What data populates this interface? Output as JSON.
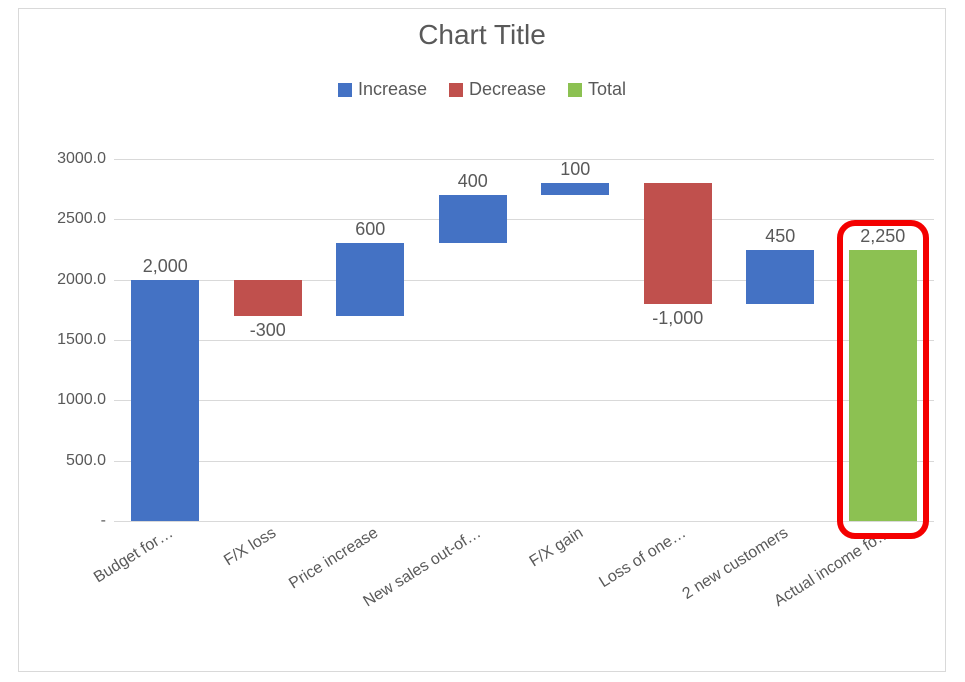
{
  "chart_data": {
    "type": "waterfall",
    "title": "Chart Title",
    "ylabel": "",
    "xlabel": "",
    "ylim": [
      0,
      3000
    ],
    "y_ticks": [
      0,
      500,
      1000,
      1500,
      2000,
      2500,
      3000
    ],
    "y_tick_labels": [
      "-",
      "500.0",
      "1000.0",
      "1500.0",
      "2000.0",
      "2500.0",
      "3000.0"
    ],
    "legend": [
      {
        "name": "Increase",
        "color": "#4472c4"
      },
      {
        "name": "Decrease",
        "color": "#c0504d"
      },
      {
        "name": "Total",
        "color": "#8cc152"
      }
    ],
    "categories_full": [
      "Budget for…",
      "F/X loss",
      "Price increase",
      "New sales out-of…",
      "F/X gain",
      "Loss of one…",
      "2 new customers",
      "Actual income fo…"
    ],
    "series": [
      {
        "category": "Budget for…",
        "value": 2000,
        "label": "2,000",
        "kind": "increase",
        "base": 0,
        "top": 2000
      },
      {
        "category": "F/X loss",
        "value": -300,
        "label": "-300",
        "kind": "decrease",
        "base": 1700,
        "top": 2000
      },
      {
        "category": "Price increase",
        "value": 600,
        "label": "600",
        "kind": "increase",
        "base": 1700,
        "top": 2300
      },
      {
        "category": "New sales out-of…",
        "value": 400,
        "label": "400",
        "kind": "increase",
        "base": 2300,
        "top": 2700
      },
      {
        "category": "F/X gain",
        "value": 100,
        "label": "100",
        "kind": "increase",
        "base": 2700,
        "top": 2800
      },
      {
        "category": "Loss of one…",
        "value": -1000,
        "label": "-1,000",
        "kind": "decrease",
        "base": 1800,
        "top": 2800
      },
      {
        "category": "2 new customers",
        "value": 450,
        "label": "450",
        "kind": "increase",
        "base": 1800,
        "top": 2250
      },
      {
        "category": "Actual income fo…",
        "value": 2250,
        "label": "2,250",
        "kind": "total",
        "base": 0,
        "top": 2250
      }
    ],
    "colors": {
      "increase": "#4472c4",
      "decrease": "#c0504d",
      "total": "#8cc152"
    },
    "annotation": {
      "highlight_index": 7,
      "note": "red rounded rectangle around the Total bar"
    }
  }
}
